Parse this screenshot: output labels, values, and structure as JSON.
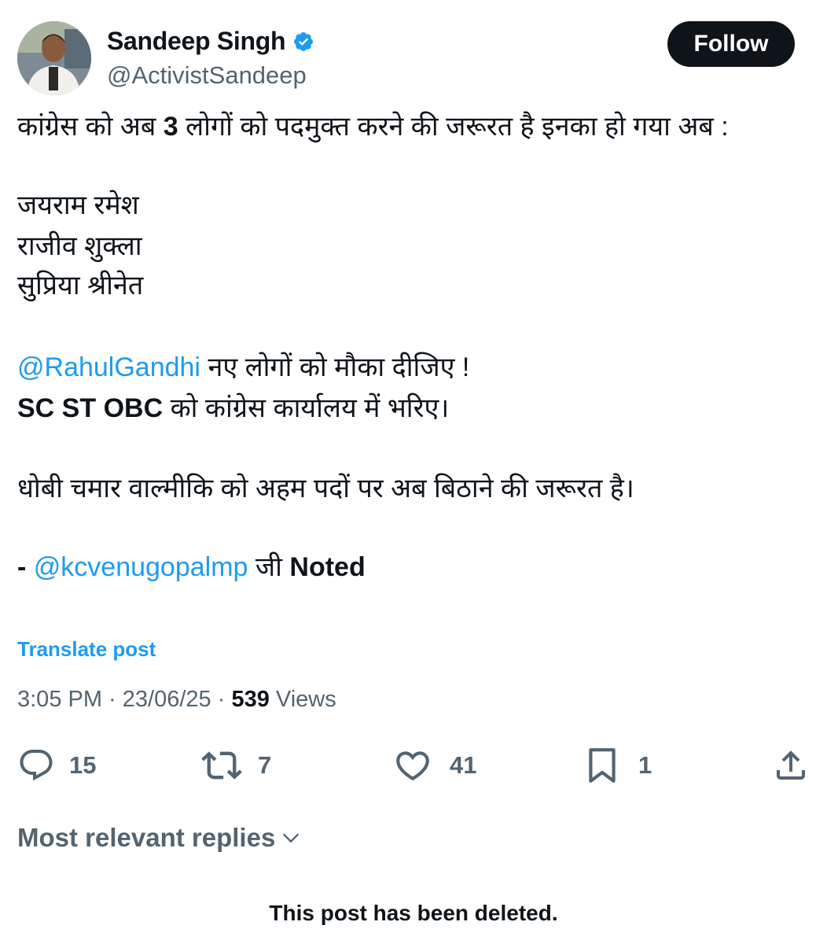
{
  "author": {
    "name": "Sandeep Singh",
    "handle": "@ActivistSandeep",
    "verified": true,
    "avatar_icon": "avatar-photo"
  },
  "follow_label": "Follow",
  "post": {
    "line1_pre": "कांग्रेस को अब ",
    "line1_bold": "3",
    "line1_post": " लोगों को पदमुक्त करने की जरूरत है इनका हो गया अब :",
    "names": [
      "जयराम रमेश",
      "राजीव शुक्ला",
      "सुप्रिया श्रीनेत"
    ],
    "mention1": "@RahulGandhi",
    "line_mention1_post": " नए लोगों को मौका दीजिए !",
    "line_sc_bold": "SC ST OBC",
    "line_sc_post": " को कांग्रेस कार्यालय में भरिए।",
    "line_dhobi": "धोबी चमार वाल्मीकि को अहम पदों पर अब बिठाने की जरूरत है।",
    "sign_prefix": "- ",
    "mention2": "@kcvenugopalmp",
    "sign_mid": " जी ",
    "sign_bold": "Noted"
  },
  "translate_label": "Translate post",
  "meta": {
    "time": "3:05 PM",
    "date": "23/06/25",
    "views_count": "539",
    "views_label": "Views",
    "separator": " · "
  },
  "actions": {
    "replies": "15",
    "reposts": "7",
    "likes": "41",
    "bookmarks": "1"
  },
  "replies_sort_label": "Most relevant replies",
  "deleted_notice": "This post has been deleted.",
  "colors": {
    "accent": "#1d9bf0",
    "text": "#0f1419",
    "secondary": "#536471"
  }
}
